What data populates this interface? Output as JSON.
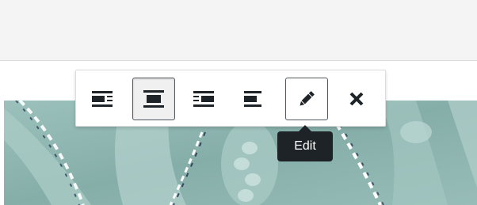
{
  "toolbar": {
    "buttons": [
      {
        "name": "align-left-button",
        "icon": "align-left-icon",
        "state": "normal"
      },
      {
        "name": "align-center-button",
        "icon": "align-center-icon",
        "state": "active"
      },
      {
        "name": "align-right-button",
        "icon": "align-right-icon",
        "state": "normal"
      },
      {
        "name": "align-none-button",
        "icon": "align-none-icon",
        "state": "normal"
      },
      {
        "name": "edit-button",
        "icon": "pencil-icon",
        "state": "focused"
      },
      {
        "name": "remove-button",
        "icon": "close-icon",
        "state": "normal"
      }
    ]
  },
  "tooltip": {
    "label": "Edit"
  },
  "colors": {
    "icon": "#1d2327",
    "tooltip_bg": "#1d2327",
    "image_base": "#8fb5b0"
  }
}
